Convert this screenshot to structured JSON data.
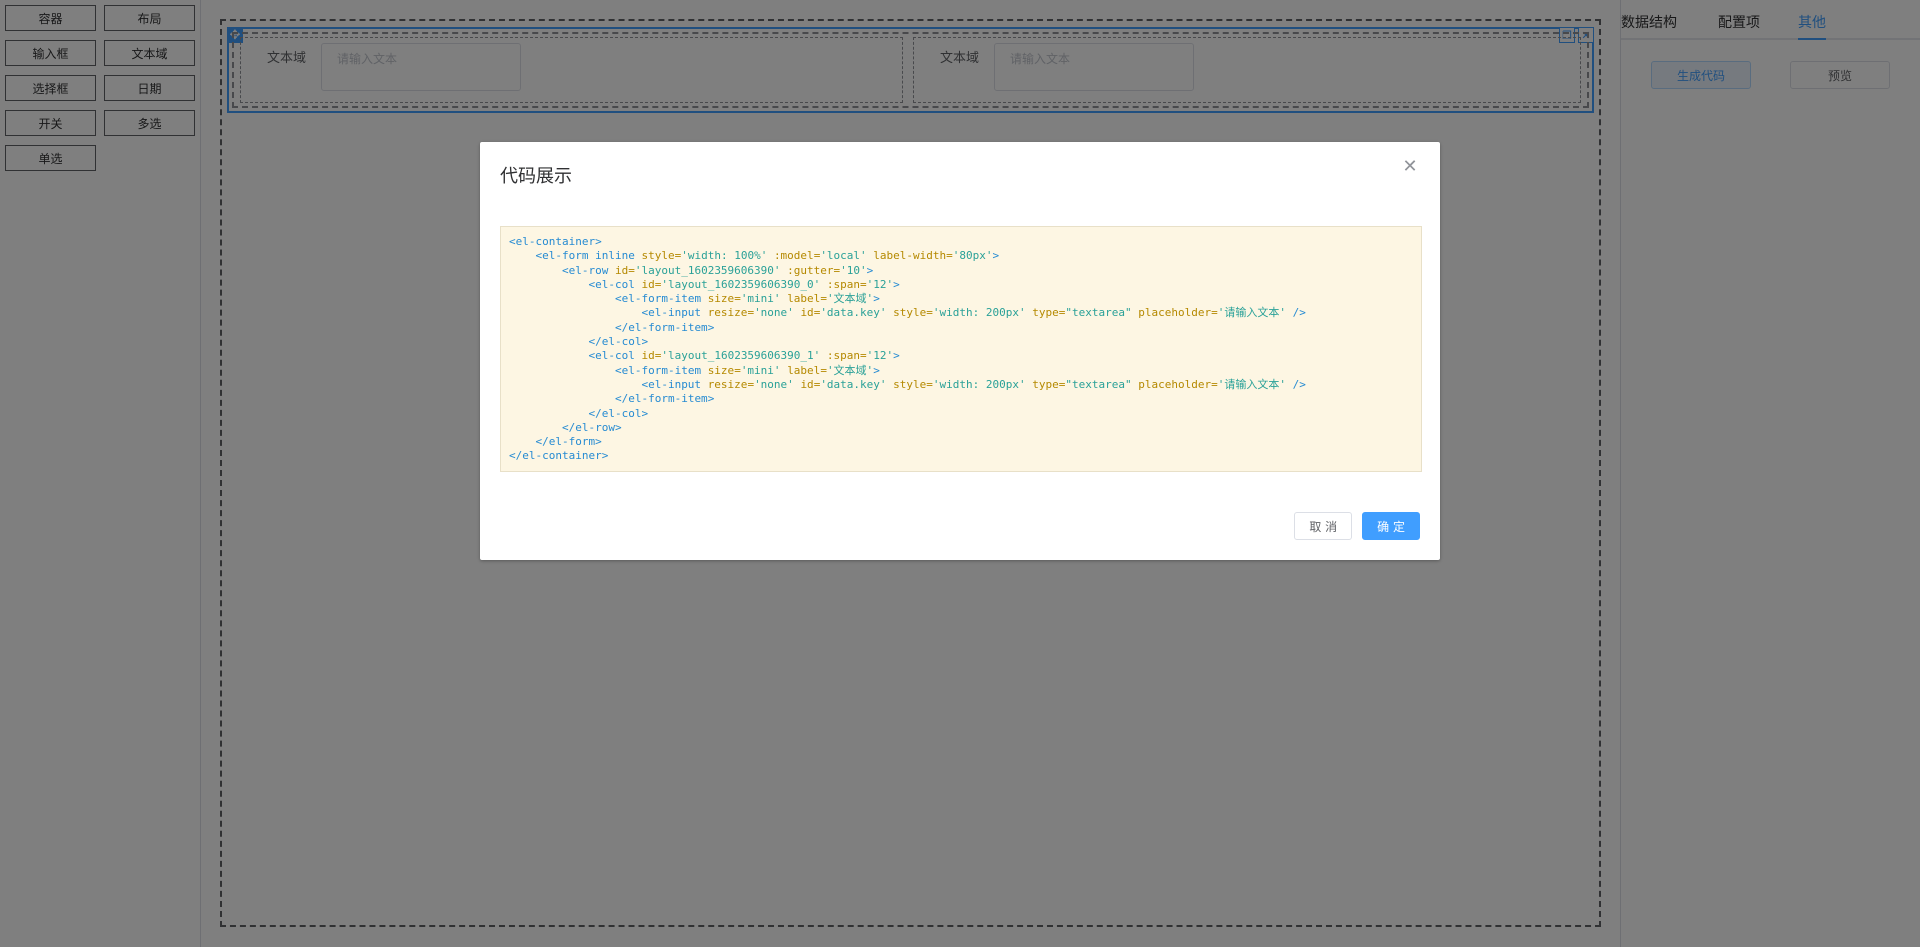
{
  "palette": {
    "items": [
      "容器",
      "布局",
      "输入框",
      "文本域",
      "选择框",
      "日期",
      "开关",
      "多选",
      "单选"
    ]
  },
  "canvas": {
    "columns": [
      {
        "label": "文本域",
        "placeholder": "请输入文本"
      },
      {
        "label": "文本域",
        "placeholder": "请输入文本"
      }
    ]
  },
  "right_panel": {
    "tabs": [
      "数据结构",
      "配置项",
      "其他"
    ],
    "active_tab": "其他",
    "generate_button": "生成代码",
    "preview_button": "预览"
  },
  "dialog": {
    "title": "代码展示",
    "cancel_label": "取 消",
    "confirm_label": "确 定",
    "code_lines": [
      "<el-container>",
      "    <el-form inline style='width: 100%' :model='local' label-width='80px'>",
      "        <el-row id='layout_1602359606390' :gutter='10'>",
      "            <el-col id='layout_1602359606390_0' :span='12'>",
      "                <el-form-item size='mini' label='文本域'>",
      "                    <el-input resize='none' id='data.key' style='width: 200px' type=\"textarea\" placeholder='请输入文本' />",
      "                </el-form-item>",
      "            </el-col>",
      "            <el-col id='layout_1602359606390_1' :span='12'>",
      "                <el-form-item size='mini' label='文本域'>",
      "                    <el-input resize='none' id='data.key' style='width: 200px' type=\"textarea\" placeholder='请输入文本' />",
      "                </el-form-item>",
      "            </el-col>",
      "        </el-row>",
      "    </el-form>",
      "</el-container>"
    ]
  },
  "colors": {
    "primary": "#409eff",
    "code_bg": "#fdf6e3",
    "code_tag": "#268bd2",
    "code_attr": "#b58900",
    "code_string": "#2aa198"
  }
}
